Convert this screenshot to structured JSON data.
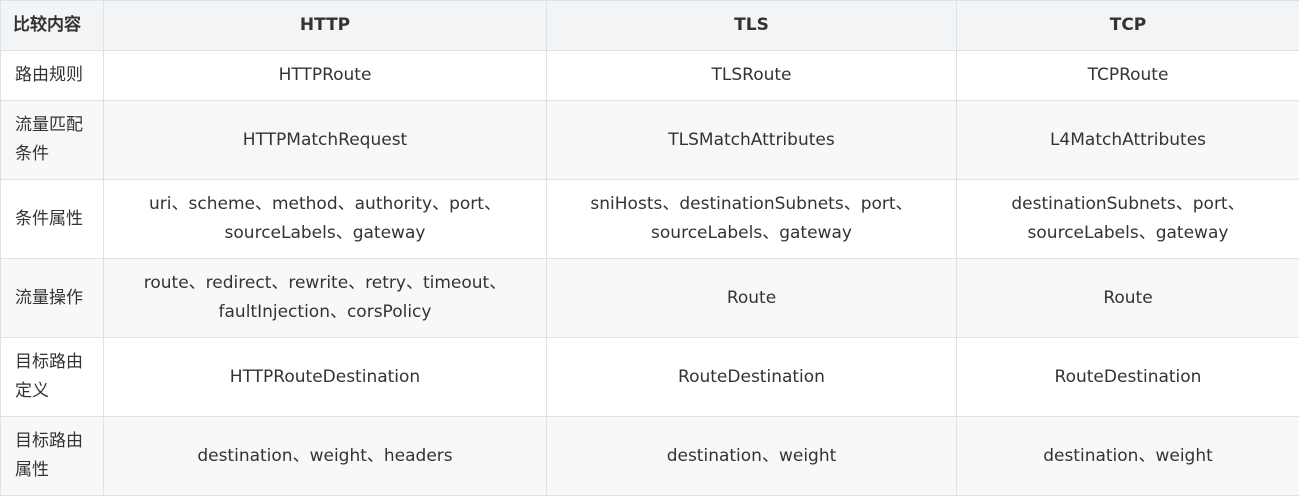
{
  "table": {
    "headers": [
      "比较内容",
      "HTTP",
      "TLS",
      "TCP"
    ],
    "rows": [
      [
        "路由规则",
        "HTTPRoute",
        "TLSRoute",
        "TCPRoute"
      ],
      [
        "流量匹配条件",
        "HTTPMatchRequest",
        "TLSMatchAttributes",
        "L4MatchAttributes"
      ],
      [
        "条件属性",
        "uri、scheme、method、authority、port、sourceLabels、gateway",
        "sniHosts、destinationSubnets、port、sourceLabels、gateway",
        "destinationSubnets、port、sourceLabels、gateway"
      ],
      [
        "流量操作",
        "route、redirect、rewrite、retry、timeout、faultInjection、corsPolicy",
        "Route",
        "Route"
      ],
      [
        "目标路由定义",
        "HTTPRouteDestination",
        "RouteDestination",
        "RouteDestination"
      ],
      [
        "目标路由属性",
        "destination、weight、headers",
        "destination、weight",
        "destination、weight"
      ]
    ]
  }
}
